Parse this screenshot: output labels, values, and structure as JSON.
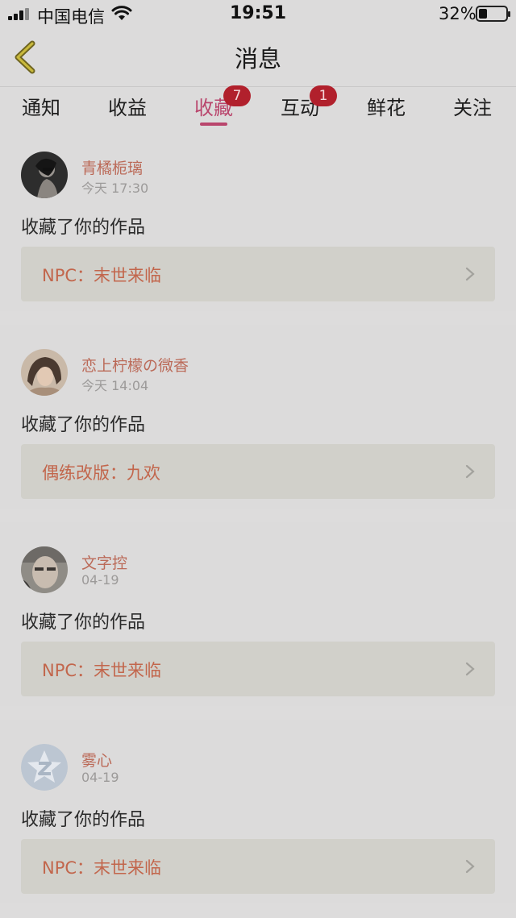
{
  "status_bar": {
    "carrier": "中国电信",
    "time": "19:51",
    "battery_percent_label": "32%",
    "battery_level": 0.32
  },
  "header": {
    "title": "消息"
  },
  "tabs": [
    {
      "label": "通知",
      "badge": ""
    },
    {
      "label": "收益",
      "badge": ""
    },
    {
      "label": "收藏",
      "badge": "7"
    },
    {
      "label": "互动",
      "badge": "1"
    },
    {
      "label": "鲜花",
      "badge": ""
    },
    {
      "label": "关注",
      "badge": ""
    }
  ],
  "active_tab": "收藏",
  "colors": {
    "accent": "#b9456c",
    "badge": "#b1202c",
    "username": "#bb6a58",
    "work_title": "#c2664c"
  },
  "feed": [
    {
      "username": "青橘栀璃",
      "time": "今天 17:30",
      "action": "收藏了你的作品",
      "work": "NPC：末世来临",
      "avatar_icon": "portrait-woman-dark-avatar"
    },
    {
      "username": "恋上柠檬の微香",
      "time": "今天 14:04",
      "action": "收藏了你的作品",
      "work": "偶练改版：九欢",
      "avatar_icon": "portrait-girl-avatar"
    },
    {
      "username": "文字控",
      "time": "04-19",
      "action": "收藏了你的作品",
      "work": "NPC：末世来临",
      "avatar_icon": "portrait-man-avatar"
    },
    {
      "username": "雾心",
      "time": "04-19",
      "action": "收藏了你的作品",
      "work": "NPC：末世来临",
      "avatar_icon": "qzone-star-default-avatar"
    }
  ]
}
